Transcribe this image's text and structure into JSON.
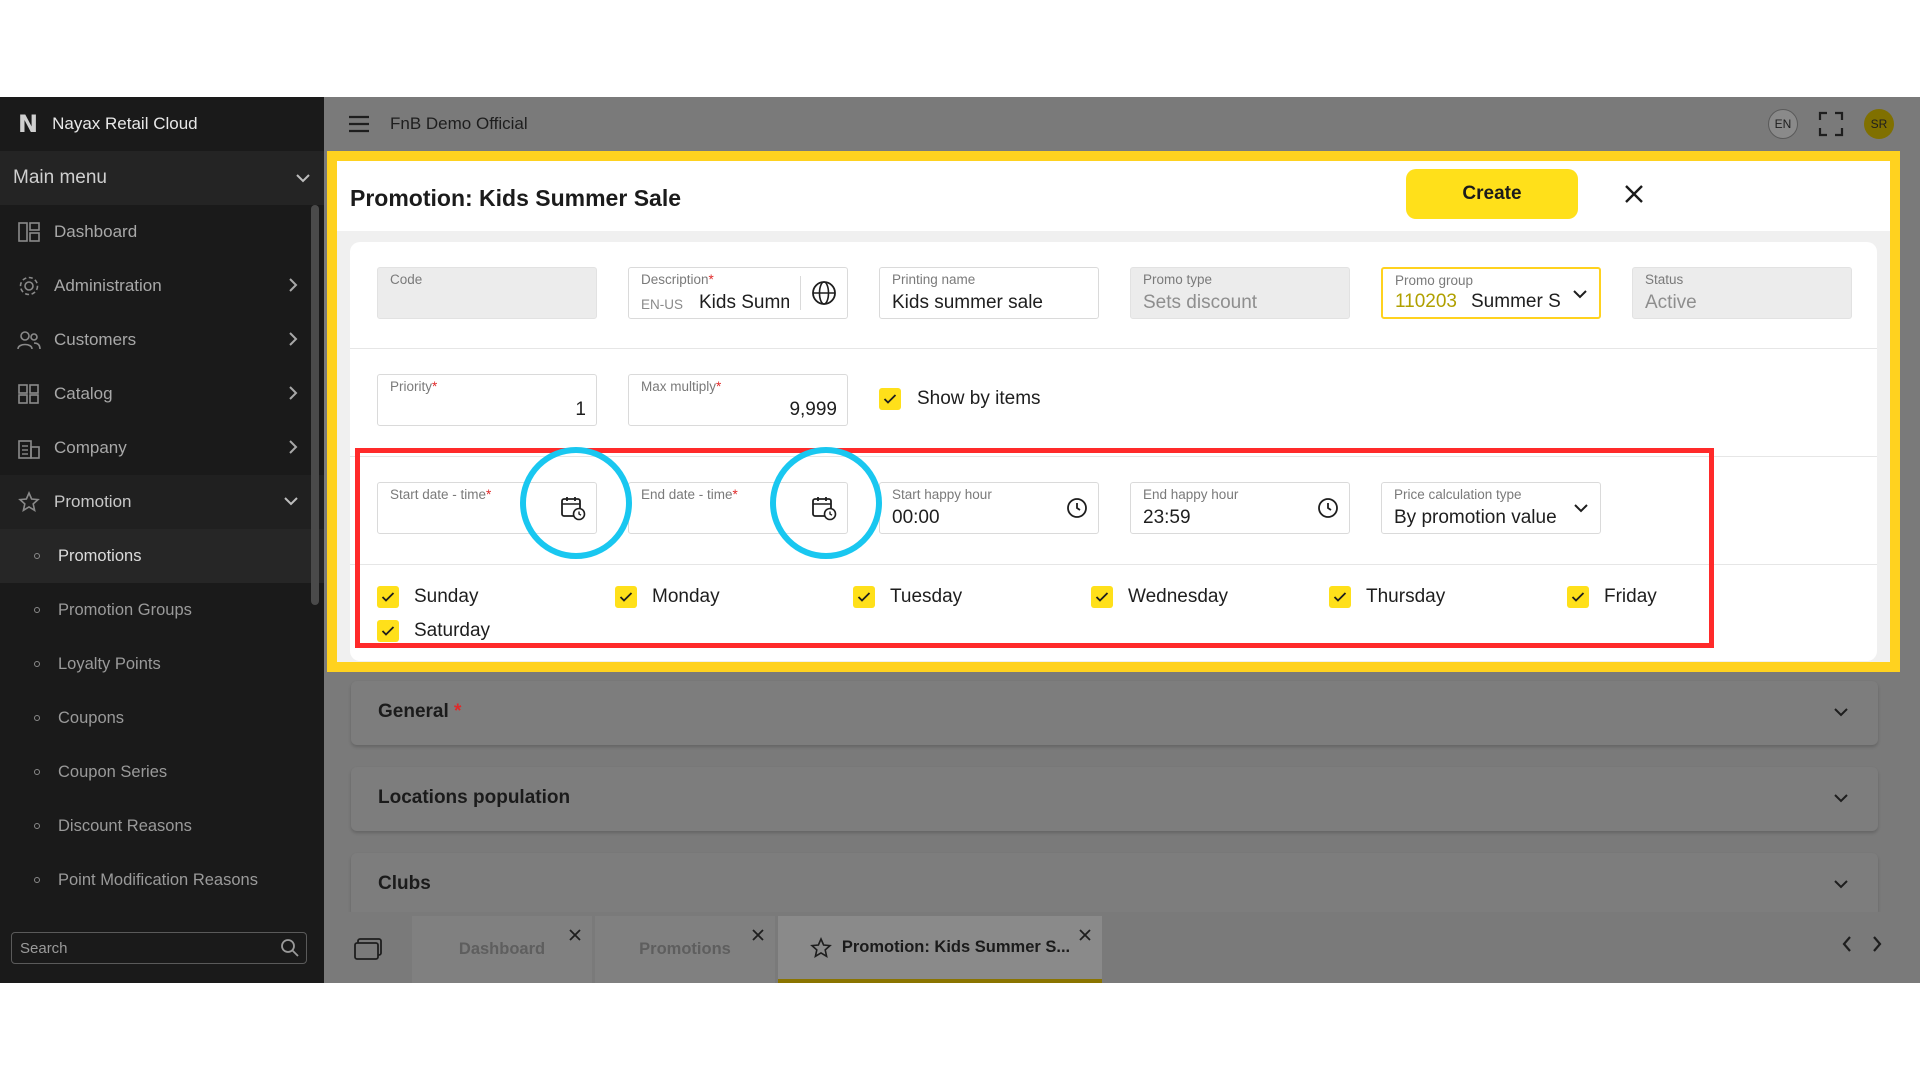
{
  "sidebar": {
    "brand": "Nayax Retail Cloud",
    "main_menu": "Main menu",
    "items": [
      {
        "label": "Dashboard",
        "icon": "dashboard-icon"
      },
      {
        "label": "Administration",
        "icon": "gear-icon"
      },
      {
        "label": "Customers",
        "icon": "users-icon"
      },
      {
        "label": "Catalog",
        "icon": "grid-icon"
      },
      {
        "label": "Company",
        "icon": "building-icon"
      },
      {
        "label": "Promotion",
        "icon": "star-icon"
      }
    ],
    "sub_items": [
      "Promotions",
      "Promotion Groups",
      "Loyalty Points",
      "Coupons",
      "Coupon Series",
      "Discount Reasons",
      "Point Modification Reasons"
    ],
    "active_sub_item": "Promotions",
    "search_placeholder": "Search"
  },
  "topbar": {
    "title": "FnB Demo Official",
    "lang": "EN",
    "user_initials": "SR"
  },
  "dialog": {
    "title": "Promotion: Kids Summer Sale",
    "create_label": "Create",
    "fields": {
      "code": {
        "label": "Code",
        "value": ""
      },
      "description": {
        "label": "Description",
        "lang": "EN-US",
        "value": "Kids Summer Sale"
      },
      "printing_name": {
        "label": "Printing name",
        "value": "Kids summer sale"
      },
      "promo_type": {
        "label": "Promo type",
        "value": "Sets discount"
      },
      "promo_group": {
        "label": "Promo group",
        "code": "110203",
        "value": "Summer S"
      },
      "status": {
        "label": "Status",
        "value": "Active"
      },
      "priority": {
        "label": "Priority",
        "value": "1"
      },
      "max_multiply": {
        "label": "Max multiply",
        "value": "9,999"
      },
      "show_by_items": {
        "label": "Show by items",
        "checked": true
      },
      "start_date": {
        "label": "Start date - time",
        "value": ""
      },
      "end_date": {
        "label": "End date - time",
        "value": ""
      },
      "start_happy_hour": {
        "label": "Start happy hour",
        "value": "00:00"
      },
      "end_happy_hour": {
        "label": "End happy hour",
        "value": "23:59"
      },
      "price_calc": {
        "label": "Price calculation type",
        "value": "By promotion value"
      }
    },
    "days": [
      {
        "label": "Sunday",
        "checked": true
      },
      {
        "label": "Monday",
        "checked": true
      },
      {
        "label": "Tuesday",
        "checked": true
      },
      {
        "label": "Wednesday",
        "checked": true
      },
      {
        "label": "Thursday",
        "checked": true
      },
      {
        "label": "Friday",
        "checked": true
      },
      {
        "label": "Saturday",
        "checked": true
      }
    ]
  },
  "sections": [
    {
      "title": "General",
      "required": true
    },
    {
      "title": "Locations population",
      "required": false
    },
    {
      "title": "Clubs",
      "required": false
    }
  ],
  "tabs": [
    "Dashboard",
    "Promotions",
    "Promotion: Kids Summer S..."
  ],
  "colors": {
    "accent": "#ffe01a",
    "highlight_box": "#ff2a2a",
    "highlight_circle": "#19c7f0",
    "dialog_border": "#ffd21f"
  }
}
